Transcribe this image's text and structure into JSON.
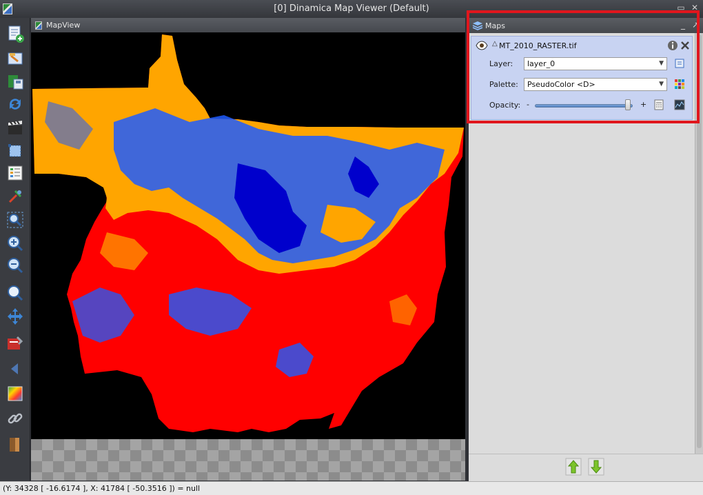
{
  "window": {
    "title": "[0] Dinamica Map Viewer (Default)"
  },
  "toolbar": {
    "tools": [
      {
        "name": "add-map-icon"
      },
      {
        "name": "edit-map-icon"
      },
      {
        "name": "save-map-icon"
      },
      {
        "name": "refresh-icon"
      },
      {
        "name": "clapperboard-icon"
      },
      {
        "name": "select-area-icon"
      },
      {
        "name": "legend-icon"
      },
      {
        "name": "pick-color-icon"
      },
      {
        "name": "zoom-extent-icon"
      },
      {
        "name": "zoom-in-icon"
      },
      {
        "name": "zoom-out-icon"
      },
      {
        "name": "zoom-window-icon"
      },
      {
        "name": "pan-icon"
      },
      {
        "name": "tools-icon"
      },
      {
        "name": "back-icon"
      },
      {
        "name": "palette-icon"
      },
      {
        "name": "link-icon"
      },
      {
        "name": "exit-icon"
      }
    ]
  },
  "mapview": {
    "title": "MapView"
  },
  "maps_panel": {
    "title": "Maps",
    "layer": {
      "name": "MT_2010_RASTER.tif",
      "layer_label": "Layer:",
      "layer_value": "layer_0",
      "palette_label": "Palette:",
      "palette_value": "PseudoColor <D>",
      "opacity_label": "Opacity:",
      "opacity_minus": "-",
      "opacity_plus": "+",
      "opacity_level": 0.95
    }
  },
  "colors": {
    "class_orange": "#ffa500",
    "class_red": "#ff0000",
    "class_blue": "#1e5cff",
    "class_dark_blue": "#0000cc",
    "highlight": "#e0161d"
  },
  "status": {
    "text": "(Y: 34328 [ -16.6174 ], X: 41784 [ -50.3516 ]) = null"
  }
}
